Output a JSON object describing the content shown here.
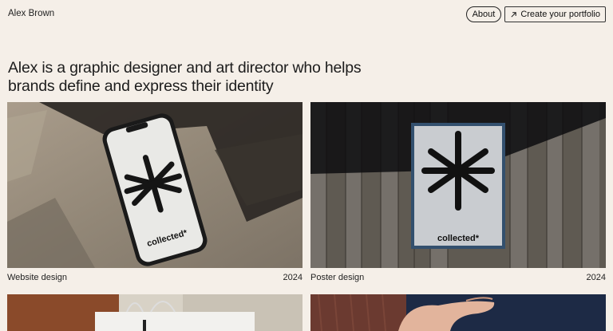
{
  "header": {
    "brand": "Alex Brown",
    "about_label": "About",
    "cta_label": "Create your portfolio",
    "cta_icon": "arrow-up-right-icon"
  },
  "intro": {
    "headline_line1": "Alex is a graphic designer and art director who helps",
    "headline_line2": "brands define and express their identity"
  },
  "projects": [
    {
      "title": "Website design",
      "year": "2024",
      "mockup_text": "collected*"
    },
    {
      "title": "Poster design",
      "year": "2024",
      "mockup_text": "collected*"
    },
    {
      "title": "",
      "year": ""
    },
    {
      "title": "",
      "year": ""
    }
  ],
  "colors": {
    "background": "#f5efe8",
    "text": "#1b1b1b"
  }
}
